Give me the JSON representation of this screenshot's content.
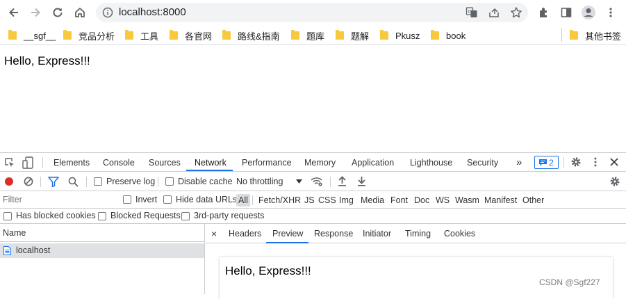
{
  "browser": {
    "url": "localhost:8000"
  },
  "bookmarks": [
    {
      "label": "__sgf__"
    },
    {
      "label": "竞品分析"
    },
    {
      "label": "工具"
    },
    {
      "label": "各官网"
    },
    {
      "label": "路线&指南"
    },
    {
      "label": "题库"
    },
    {
      "label": "题解"
    },
    {
      "label": "Pkusz"
    },
    {
      "label": "book"
    }
  ],
  "other_bookmarks": "其他书签",
  "page": {
    "text": "Hello, Express!!!"
  },
  "devtools": {
    "tabs": [
      "Elements",
      "Console",
      "Sources",
      "Network",
      "Performance",
      "Memory",
      "Application",
      "Lighthouse",
      "Security"
    ],
    "active_tab": "Network",
    "more_tabs": "»",
    "message_count": "2",
    "toolbar": {
      "preserve_log": "Preserve log",
      "disable_cache": "Disable cache",
      "throttling": "No throttling"
    },
    "filter": {
      "placeholder": "Filter",
      "invert": "Invert",
      "hide_data_urls": "Hide data URLs",
      "types": [
        "All",
        "Fetch/XHR",
        "JS",
        "CSS",
        "Img",
        "Media",
        "Font",
        "Doc",
        "WS",
        "Wasm",
        "Manifest",
        "Other"
      ],
      "selected_type": "All"
    },
    "options": {
      "blocked_cookies": "Has blocked cookies",
      "blocked_requests": "Blocked Requests",
      "third_party": "3rd-party requests"
    },
    "requests": {
      "column": "Name",
      "rows": [
        {
          "name": "localhost"
        }
      ]
    },
    "detail": {
      "close": "×",
      "tabs": [
        "Headers",
        "Preview",
        "Response",
        "Initiator",
        "Timing",
        "Cookies"
      ],
      "active_tab": "Preview",
      "preview_text": "Hello, Express!!!"
    }
  },
  "watermark": "CSDN @Sgf227",
  "colors": {
    "accent": "#1a73e8",
    "record": "#d93025",
    "folder": "#f8c93c"
  }
}
